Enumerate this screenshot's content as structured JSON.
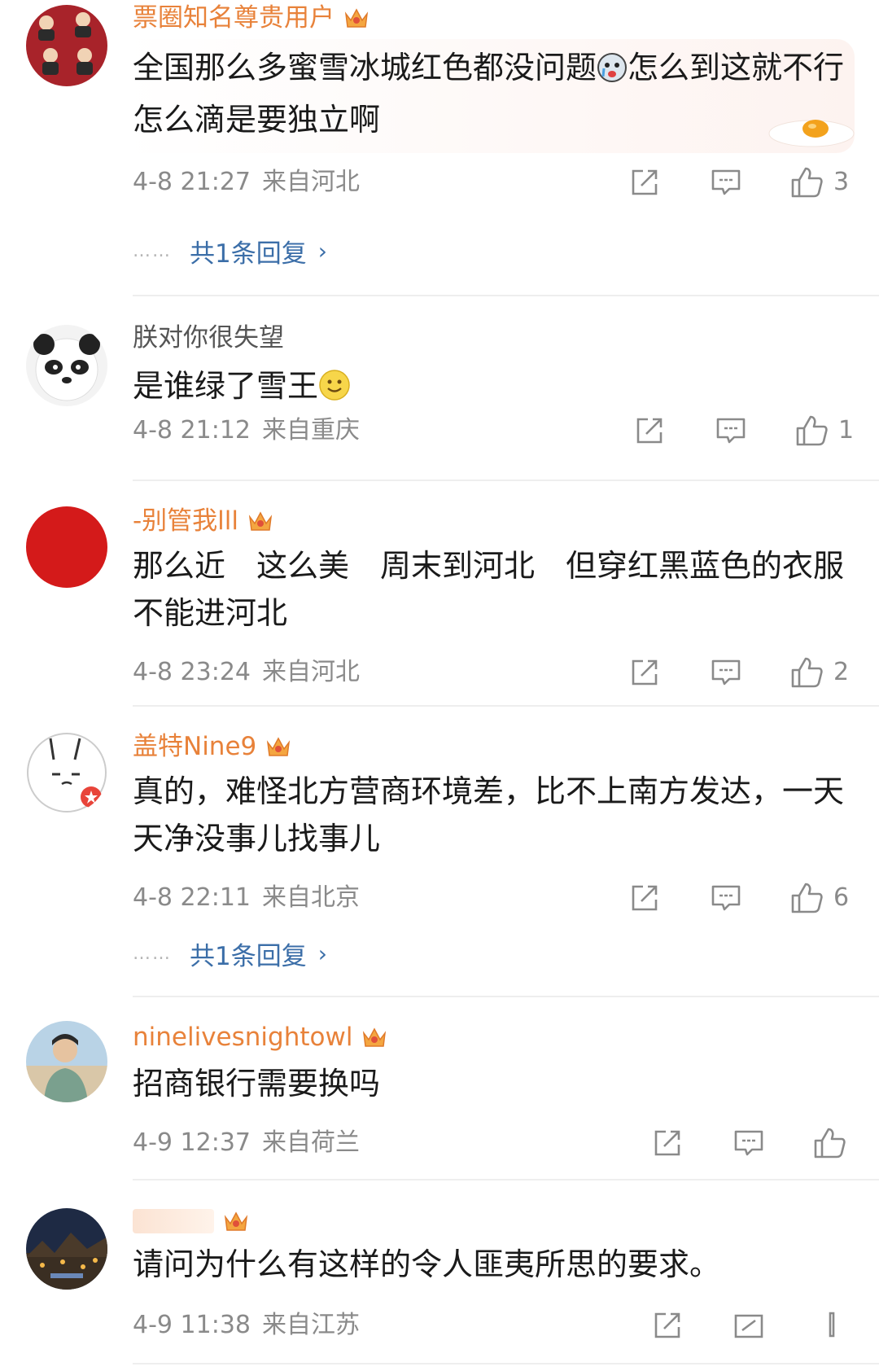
{
  "colors": {
    "vip_name": "#e8823a",
    "plain_name": "#555555",
    "meta": "#8a8a8a",
    "reply_link": "#3b6ea8",
    "icon_stroke": "#8a8a8a"
  },
  "comments": [
    {
      "username": "票圈知名尊贵用户",
      "vip": true,
      "text": "全国那么多蜜雪冰城红色都没问题",
      "text_after_emoji": "怎么到这就不行怎么滴是要独立啊",
      "emoji": "crying-face-emoji",
      "timestamp": "4-8 21:27",
      "location": "来自河北",
      "likes": "3",
      "replies": "共1条回复"
    },
    {
      "username": "朕对你很失望",
      "vip": false,
      "text": "是谁绿了雪王",
      "emoji": "smile-emoji",
      "timestamp": "4-8 21:12",
      "location": "来自重庆",
      "likes": "1"
    },
    {
      "username": "-别管我lll",
      "vip": true,
      "text": "那么近　这么美　周末到河北　但穿红黑蓝色的衣服不能进河北",
      "timestamp": "4-8 23:24",
      "location": "来自河北",
      "likes": "2"
    },
    {
      "username": "盖特Nine9",
      "vip": true,
      "text": "真的，难怪北方营商环境差，比不上南方发达，一天天净没事儿找事儿",
      "timestamp": "4-8 22:11",
      "location": "来自北京",
      "likes": "6",
      "replies": "共1条回复"
    },
    {
      "username": "ninelivesnightowl",
      "vip": true,
      "text": "招商银行需要换吗",
      "timestamp": "4-9 12:37",
      "location": "来自荷兰",
      "likes": ""
    },
    {
      "username": "",
      "vip": true,
      "text": "请问为什么有这样的令人匪夷所思的要求。",
      "timestamp": "4-9 11:38",
      "location": "来自江苏",
      "likes": ""
    }
  ]
}
